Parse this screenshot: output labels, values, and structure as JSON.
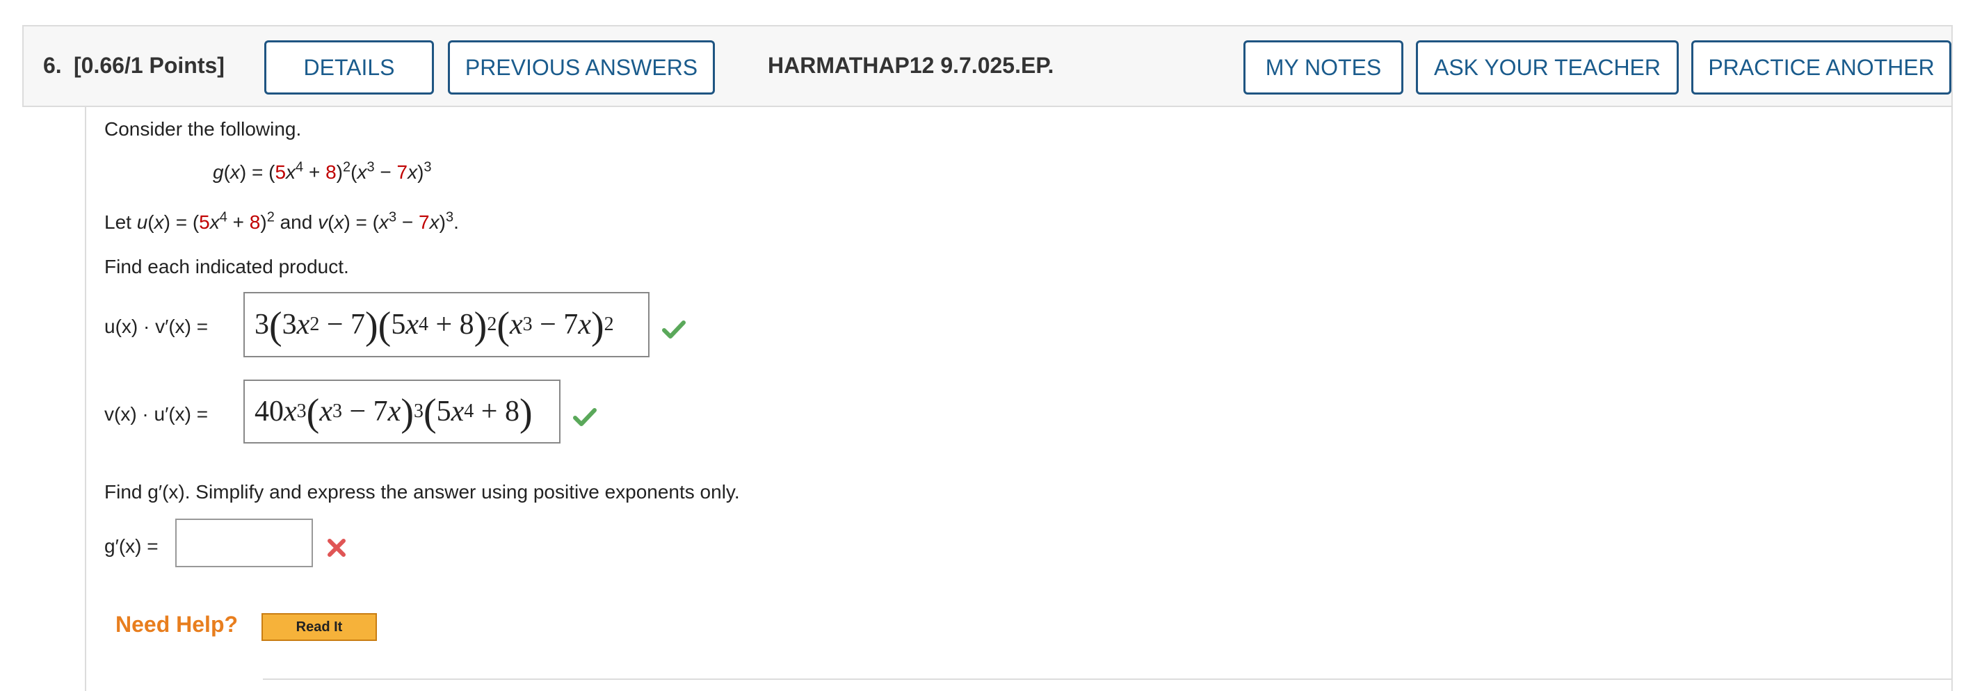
{
  "question": {
    "number": "6.",
    "points": "[0.66/1 Points]",
    "reference": "HARMATHAP12 9.7.025.EP."
  },
  "toolbar": {
    "details": "DETAILS",
    "previous_answers": "PREVIOUS ANSWERS",
    "my_notes": "MY NOTES",
    "ask_teacher": "ASK YOUR TEACHER",
    "practice_another": "PRACTICE ANOTHER"
  },
  "body": {
    "intro": "Consider the following.",
    "find_product": "Find each indicated product.",
    "find_gprime": "Find g′(x). Simplify and express the answer using positive exponents only."
  },
  "answers": {
    "uv_prime": {
      "label": "u(x) · v′(x)  =",
      "status": "correct"
    },
    "vu_prime": {
      "label": "v(x) · u′(x)  =",
      "status": "correct"
    },
    "g_prime": {
      "label": "g′(x) =",
      "value": "",
      "status": "incorrect"
    }
  },
  "help": {
    "need_help": "Need Help?",
    "read_it": "Read It"
  },
  "colors": {
    "accent": "#1a5b8c",
    "correct": "#5aa85a",
    "incorrect": "#e05555",
    "highlight_number": "#c00000",
    "need_help": "#e87e1e"
  }
}
